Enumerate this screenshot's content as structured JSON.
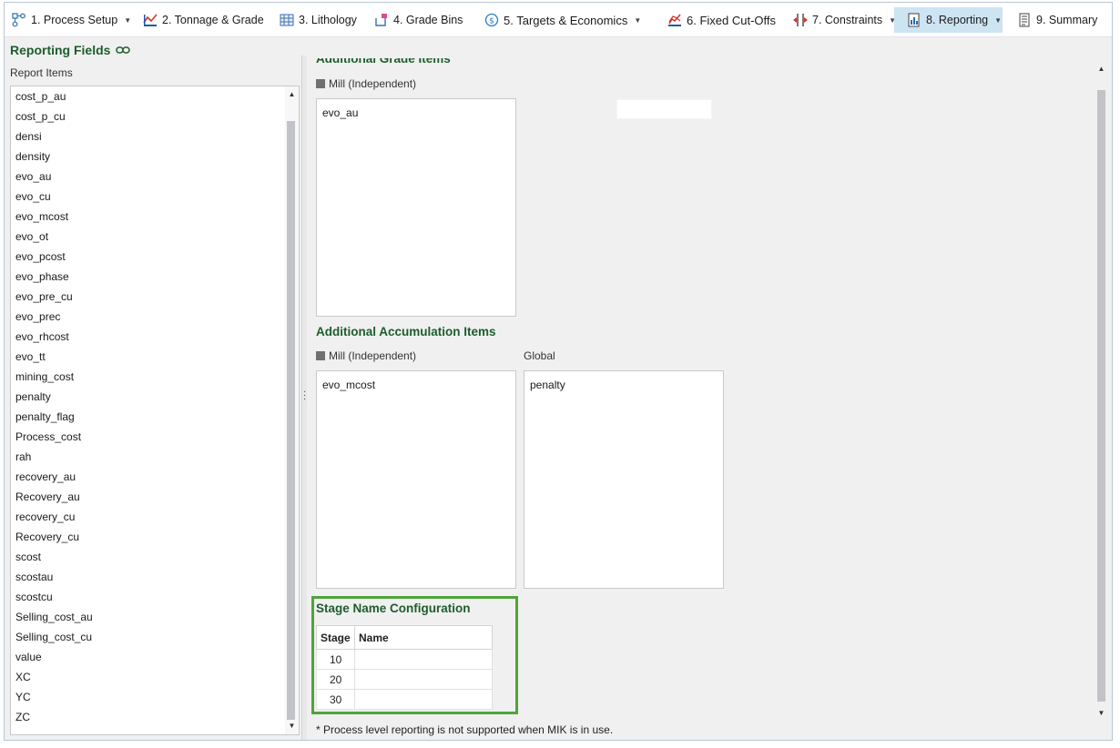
{
  "toolbar": {
    "tabs": [
      {
        "label": "1. Process Setup",
        "icon": "process-setup-icon",
        "dropdown": true
      },
      {
        "label": "2. Tonnage & Grade",
        "icon": "tonnage-chart-icon",
        "dropdown": false
      },
      {
        "label": "3. Lithology",
        "icon": "lithology-icon",
        "dropdown": false
      },
      {
        "label": "4. Grade Bins",
        "icon": "grade-bins-icon",
        "dropdown": false
      },
      {
        "label": "5. Targets & Economics",
        "icon": "dollar-icon",
        "dropdown": true
      },
      {
        "label": "6. Fixed Cut-Offs",
        "icon": "cutoff-chart-icon",
        "dropdown": false
      },
      {
        "label": "7. Constraints",
        "icon": "constraints-icon",
        "dropdown": true
      },
      {
        "label": "8. Reporting",
        "icon": "reporting-icon",
        "dropdown": true,
        "active": true
      },
      {
        "label": "9. Summary",
        "icon": "summary-icon",
        "dropdown": false
      }
    ]
  },
  "left_panel": {
    "title": "Reporting Fields",
    "title_icon": "link-icon",
    "subtitle": "Report Items",
    "items": [
      "cost_p_au",
      "cost_p_cu",
      "densi",
      "density",
      "evo_au",
      "evo_cu",
      "evo_mcost",
      "evo_ot",
      "evo_pcost",
      "evo_phase",
      "evo_pre_cu",
      "evo_prec",
      "evo_rhcost",
      "evo_tt",
      "mining_cost",
      "penalty",
      "penalty_flag",
      "Process_cost",
      "rah",
      "recovery_au",
      "Recovery_au",
      "recovery_cu",
      "Recovery_cu",
      "scost",
      "scostau",
      "scostcu",
      "Selling_cost_au",
      "Selling_cost_cu",
      "value",
      "XC",
      "YC",
      "ZC"
    ]
  },
  "grade_section": {
    "title": "Additional Grade Items",
    "mill_label": "Mill (Independent)",
    "mill_items": [
      "evo_au"
    ]
  },
  "accumulation_section": {
    "title": "Additional Accumulation Items",
    "mill_label": "Mill (Independent)",
    "global_label": "Global",
    "mill_items": [
      "evo_mcost"
    ],
    "global_items": [
      "penalty"
    ]
  },
  "stage_section": {
    "title": "Stage Name Configuration",
    "headers": [
      "Stage",
      "Name"
    ],
    "rows": [
      {
        "stage": "10",
        "name": ""
      },
      {
        "stage": "20",
        "name": ""
      },
      {
        "stage": "30",
        "name": ""
      }
    ]
  },
  "footnote": "* Process level reporting is not supported when MIK is in use.",
  "colors": {
    "section_title": "#1d5d2d",
    "active_tab": "#cde4f2",
    "highlight_frame": "#4fa43a"
  }
}
